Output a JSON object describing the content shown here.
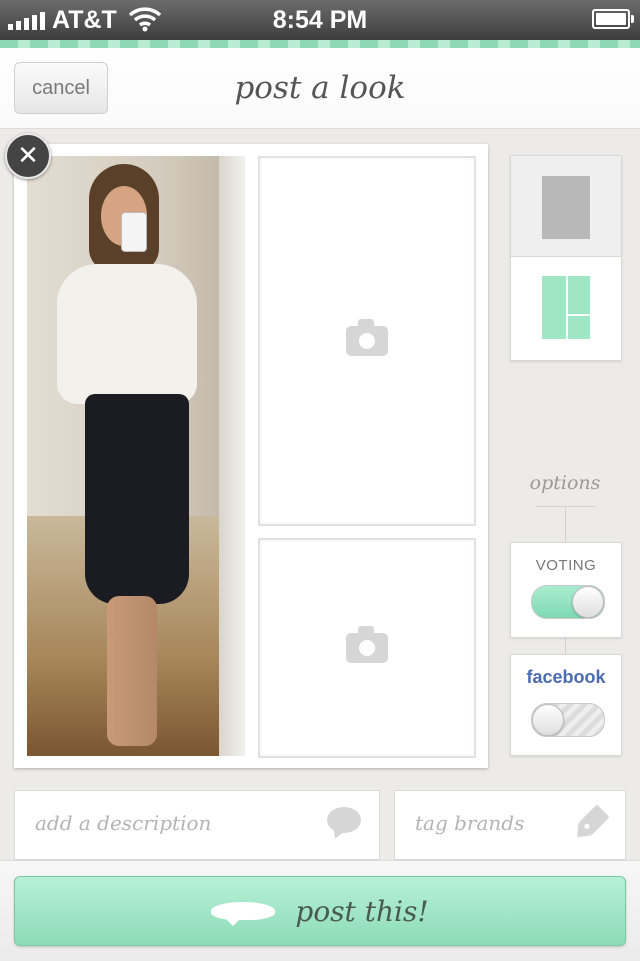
{
  "status_bar": {
    "carrier": "AT&T",
    "time": "8:54 PM",
    "battery_level": 1.0
  },
  "header": {
    "cancel_label": "cancel",
    "title": "post a look"
  },
  "collage": {
    "selected_layout": 2
  },
  "options": {
    "label": "options",
    "voting": {
      "label": "VOTING",
      "enabled": true
    },
    "facebook": {
      "label": "facebook",
      "enabled": false
    }
  },
  "fields": {
    "description_placeholder": "add a description",
    "tags_placeholder": "tag brands"
  },
  "footer": {
    "post_label": "post this!"
  },
  "colors": {
    "accent": "#9fe6c4",
    "facebook": "#4b6cb0"
  },
  "icons": [
    "close-icon",
    "camera-icon",
    "speech-bubble-icon",
    "tag-icon",
    "cloud-post-icon"
  ]
}
